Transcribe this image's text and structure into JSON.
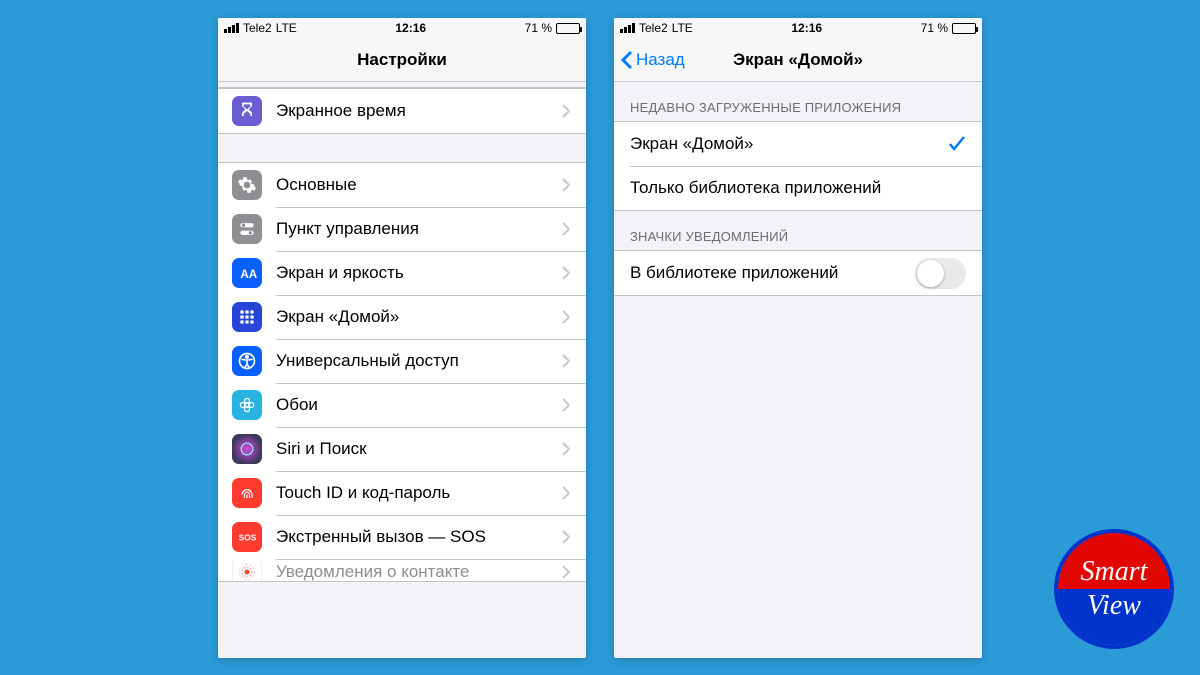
{
  "status": {
    "carrier": "Tele2",
    "network": "LTE",
    "time": "12:16",
    "battery_pct": "71 %"
  },
  "left": {
    "title": "Настройки",
    "group1": [
      {
        "label": "Экранное время"
      }
    ],
    "group2": [
      {
        "label": "Основные"
      },
      {
        "label": "Пункт управления"
      },
      {
        "label": "Экран и яркость"
      },
      {
        "label": "Экран «Домой»"
      },
      {
        "label": "Универсальный доступ"
      },
      {
        "label": "Обои"
      },
      {
        "label": "Siri и Поиск"
      },
      {
        "label": "Touch ID и код-пароль"
      },
      {
        "label": "Экстренный вызов — SOS"
      }
    ],
    "cutoff_label": "Уведомления о контакте"
  },
  "right": {
    "back": "Назад",
    "title": "Экран «Домой»",
    "section1_header": "НЕДАВНО ЗАГРУЖЕННЫЕ ПРИЛОЖЕНИЯ",
    "section1_items": [
      {
        "label": "Экран «Домой»",
        "selected": true
      },
      {
        "label": "Только библиотека приложений",
        "selected": false
      }
    ],
    "section2_header": "ЗНАЧКИ УВЕДОМЛЕНИЙ",
    "section2_items": [
      {
        "label": "В библиотеке приложений",
        "toggle": false
      }
    ]
  },
  "logo": {
    "top": "Smart",
    "bot": "View"
  }
}
